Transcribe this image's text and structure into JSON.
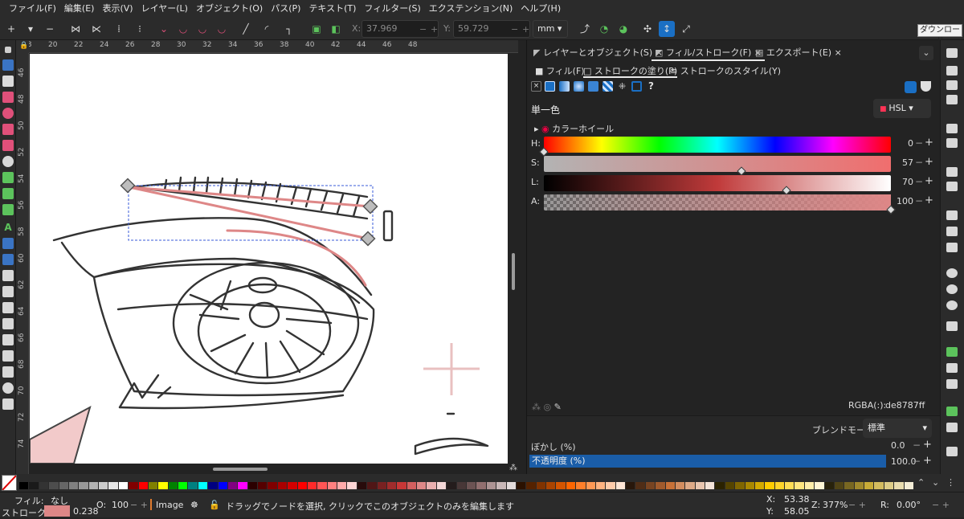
{
  "menu": [
    "ファイル(F)",
    "編集(E)",
    "表示(V)",
    "レイヤー(L)",
    "オブジェクト(O)",
    "パス(P)",
    "テキスト(T)",
    "フィルター(S)",
    "エクステンション(N)",
    "ヘルプ(H)"
  ],
  "toolbar": {
    "x_label": "X:",
    "x_value": "37.969",
    "y_label": "Y:",
    "y_value": "59.729",
    "unit": "mm",
    "tooltip": "ダウンロード"
  },
  "ruler": {
    "h_ticks": [
      "18",
      "20",
      "22",
      "24",
      "26",
      "28",
      "30",
      "32",
      "34",
      "36",
      "38",
      "40",
      "42",
      "44",
      "46",
      "48"
    ],
    "v_ticks": [
      "46",
      "48",
      "50",
      "52",
      "54",
      "56",
      "58",
      "60",
      "62",
      "64",
      "66",
      "68",
      "70",
      "72",
      "74"
    ]
  },
  "dock": {
    "tabs": [
      "レイヤーとオブジェクト(S)",
      "フィル/ストローク(F)",
      "エクスポート(E)"
    ],
    "close_glyph": "×",
    "subtabs": [
      "フィル(F)",
      "ストロークの塗り(P)",
      "ストロークのスタイル(Y)"
    ],
    "paint_unknown": "?",
    "flat_color_label": "単一色",
    "color_mode": "HSL",
    "color_wheel_label": "カラーホイール",
    "sliders": [
      {
        "label": "H:",
        "value": "0",
        "fraction": 0.0
      },
      {
        "label": "S:",
        "value": "57",
        "fraction": 0.57
      },
      {
        "label": "L:",
        "value": "70",
        "fraction": 0.7
      },
      {
        "label": "A:",
        "value": "100",
        "fraction": 1.0
      }
    ],
    "rgba_label": "RGBA(:):",
    "rgba_value": "de8787ff",
    "blend_label": "ブレンドモード:",
    "blend_value": "標準",
    "blur_label": "ぼかし (%)",
    "blur_value": "0.0",
    "opacity_label": "不透明度 (%)",
    "opacity_value": "100.0",
    "opacity_fraction": 1.0
  },
  "colors": {
    "stroke": "#de8787",
    "accent": "#1a6fc4"
  },
  "status": {
    "fill_label": "フィル:",
    "fill_value": "なし",
    "stroke_label": "ストローク:",
    "stroke_width": "0.238",
    "opacity_label": "O:",
    "opacity_value": "100",
    "layer": "Image",
    "message": "ドラッグでノードを選択, クリックでこのオブジェクトのみを編集します",
    "x_label": "X:",
    "x_value": "53.38",
    "y_label": "Y:",
    "y_value": "58.05",
    "zoom_label": "Z:",
    "zoom_value": "377%",
    "rot_label": "R:",
    "rot_value": "0.00°"
  },
  "palette_colors": [
    "#000000",
    "#1a1a1a",
    "#333333",
    "#4d4d4d",
    "#666666",
    "#808080",
    "#999999",
    "#b3b3b3",
    "#cccccc",
    "#e6e6e6",
    "#ffffff",
    "#800000",
    "#ff0000",
    "#808000",
    "#ffff00",
    "#008000",
    "#00ff00",
    "#008080",
    "#00ffff",
    "#000080",
    "#0000ff",
    "#800080",
    "#ff00ff",
    "#2b0000",
    "#550000",
    "#800000",
    "#aa0000",
    "#d40000",
    "#ff0000",
    "#ff2a2a",
    "#ff5555",
    "#ff8080",
    "#ffaaaa",
    "#ffd5d5",
    "#280b0b",
    "#501616",
    "#782121",
    "#a02c2c",
    "#c83737",
    "#d35f5f",
    "#de8787",
    "#e9afaf",
    "#f4d7d7",
    "#241c1c",
    "#483737",
    "#6c5353",
    "#916f6f",
    "#ac9393",
    "#c8b7b7",
    "#e3dbdb",
    "#2b1100",
    "#552200",
    "#803300",
    "#aa4400",
    "#d45500",
    "#ff6600",
    "#ff7f2a",
    "#ff9955",
    "#ffb380",
    "#ffccaa",
    "#ffe6d5",
    "#28170b",
    "#502d16",
    "#784421",
    "#a05a2c",
    "#c87137",
    "#d38d5f",
    "#deaa87",
    "#e9c6af",
    "#f4e3d7",
    "#2b2200",
    "#554400",
    "#806600",
    "#aa8800",
    "#d4aa00",
    "#ffcc00",
    "#ffd42a",
    "#ffdd55",
    "#ffe680",
    "#ffeeaa",
    "#fff6d5",
    "#28220b",
    "#504416",
    "#786721",
    "#a0892c",
    "#c8ab37",
    "#d4bc5f",
    "#decd87",
    "#e9ddaf",
    "#f4eed7"
  ]
}
